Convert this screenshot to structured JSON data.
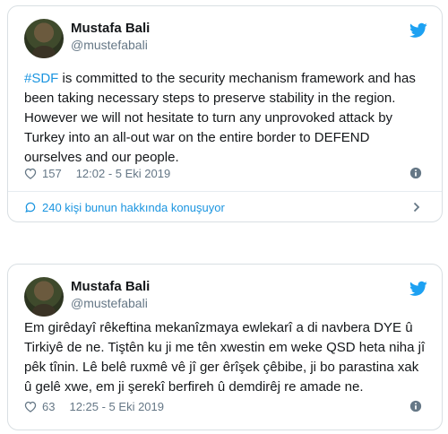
{
  "tweets": [
    {
      "author_name": "Mustafa Bali",
      "author_handle": "@mustefabali",
      "hashtag": "#SDF",
      "text_rest": " is committed to the security mechanism framework and has been taking necessary steps to preserve stability in the region. However we will not hesitate to turn any unprovoked attack by Turkey into an all-out war on the entire border to DEFEND ourselves and our people.",
      "likes": "157",
      "timestamp": "12:02 - 5 Eki 2019",
      "conversation": "240 kişi bunun hakkında konuşuyor"
    },
    {
      "author_name": "Mustafa Bali",
      "author_handle": "@mustefabali",
      "text": "Em girêdayî rêkeftina mekanîzmaya ewlekarî a di navbera DYE û Tirkiyê de ne. Tiştên ku ji me tên xwestin em weke QSD heta niha jî pêk tînin. Lê belê ruxmê vê jî ger êrîşek çêbibe, ji bo parastina xak û gelê xwe, em ji şerekî berfireh û demdirêj re amade ne.",
      "likes": "63",
      "timestamp": "12:25 - 5 Eki 2019"
    }
  ],
  "icons": {
    "brand": "twitter-bird-icon",
    "like": "heart-icon",
    "info": "info-icon",
    "reply": "speech-bubble-icon",
    "chevron": "chevron-right-icon"
  },
  "colors": {
    "accent": "#1b95e0",
    "text": "#14171a",
    "secondary": "#657786",
    "border": "#d9dfe3"
  }
}
